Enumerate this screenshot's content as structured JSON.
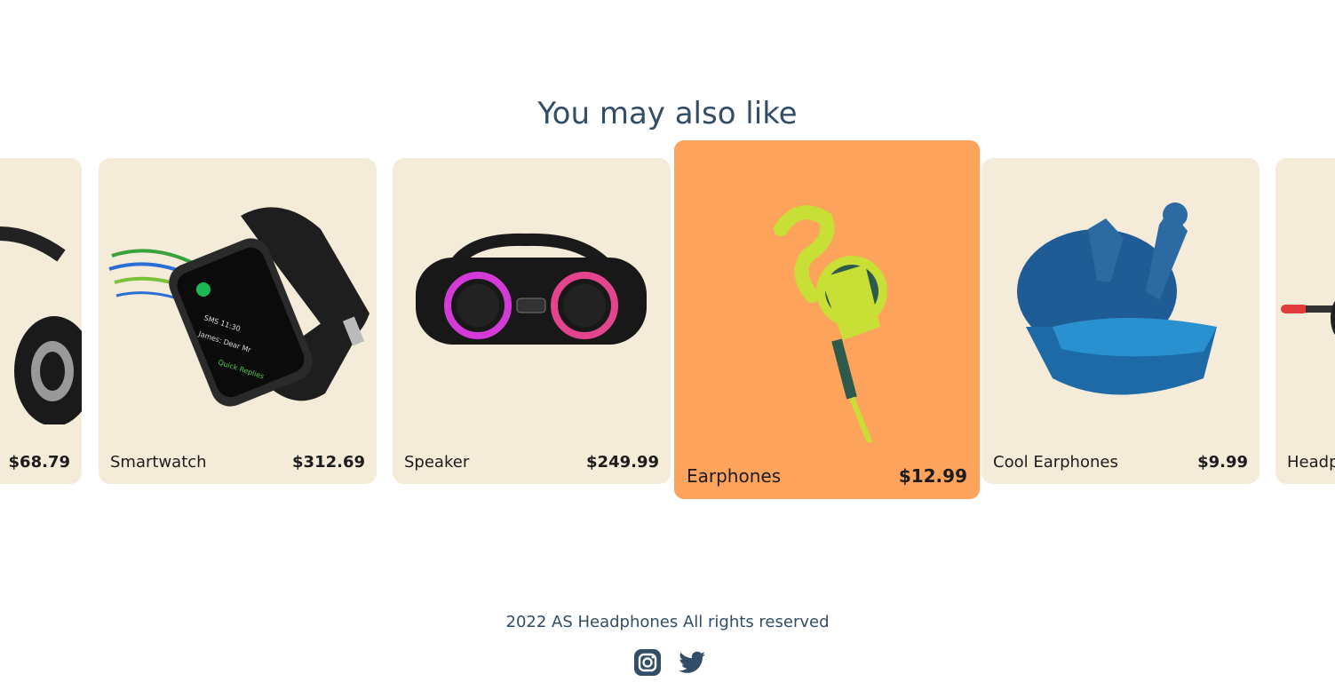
{
  "section": {
    "title": "You may also like"
  },
  "products": [
    {
      "name": "",
      "price": "$68.79",
      "image": "headphones-icon"
    },
    {
      "name": "Smartwatch",
      "price": "$312.69",
      "image": "smartwatch-icon"
    },
    {
      "name": "Speaker",
      "price": "$249.99",
      "image": "speaker-icon"
    },
    {
      "name": "Earphones",
      "price": "$12.99",
      "image": "earphones-icon",
      "active": true
    },
    {
      "name": "Cool Earphones",
      "price": "$9.99",
      "image": "earbuds-case-icon"
    },
    {
      "name": "Headphones",
      "price": "",
      "image": "headphones-icon"
    }
  ],
  "colors": {
    "card_bg": "#f5ebd9",
    "active_card_bg": "#fda35c",
    "heading": "#324d67"
  },
  "footer": {
    "copyright": "2022 AS Headphones All rights reserved",
    "social": [
      {
        "name": "instagram-icon"
      },
      {
        "name": "twitter-icon"
      }
    ]
  }
}
